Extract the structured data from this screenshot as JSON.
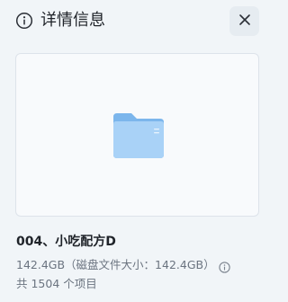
{
  "header": {
    "title": "详情信息",
    "info_icon": "info-circle-icon",
    "close_icon": "close-icon"
  },
  "preview": {
    "icon": "folder-icon"
  },
  "details": {
    "name": "004、小吃配方D",
    "size": "142.4GB（磁盘文件大小：142.4GB）",
    "help_icon": "info-circle-icon",
    "item_count": "共 1504 个项目"
  },
  "colors": {
    "background": "#f1f5f8",
    "folder_light": "#a9d2f7",
    "folder_dark": "#7cb6ec",
    "text_primary": "#1f2329",
    "text_secondary": "#6b7480"
  }
}
